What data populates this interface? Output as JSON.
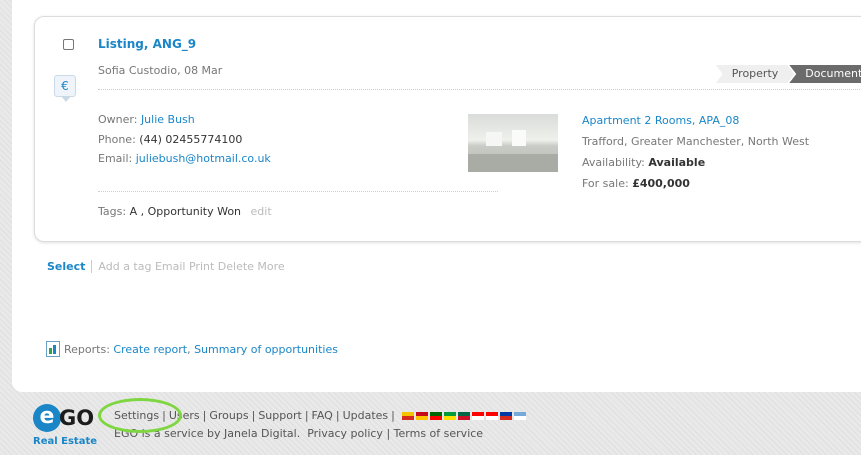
{
  "listing": {
    "title": "Listing, ANG_9",
    "subtitle": "Sofia Custodio, 08 Mar",
    "currency_icon": "€",
    "steps": [
      "Property",
      "Documents"
    ],
    "owner_label": "Owner:",
    "owner_name": "Julie Bush",
    "phone_label": "Phone:",
    "phone": "(44) 02455774100",
    "email_label": "Email:",
    "email": "juliebush@hotmail.co.uk",
    "property_title": "Apartment 2 Rooms, APA_08",
    "property_location": "Trafford, Greater Manchester, North West",
    "availability_label": "Availability:",
    "availability": "Available",
    "sale_label": "For sale:",
    "sale_price": "£400,000",
    "tags_label": "Tags:",
    "tags": "A , Opportunity Won",
    "edit_label": "edit"
  },
  "actions": {
    "select": "Select",
    "others": "Add a tag Email Print Delete More"
  },
  "reports": {
    "label": "Reports:",
    "create": "Create report",
    "comma": ",",
    "summary": "Summary of opportunities"
  },
  "footer": {
    "logo_e": "e",
    "logo_go": "GO",
    "logo_sub": "Real Estate",
    "nav": [
      "Settings",
      "Users",
      "Groups",
      "Support",
      "FAQ",
      "Updates"
    ],
    "separator": "|",
    "service_text": "EGO is a service by Janela Digital.",
    "privacy": "Privacy policy",
    "terms": "Terms of service",
    "flag_colors": [
      [
        "#f4c400",
        "#d52b1e"
      ],
      [
        "#c60b1e",
        "#ffc400"
      ],
      [
        "#006600",
        "#ff0000"
      ],
      [
        "#009c3b",
        "#ffdf00"
      ],
      [
        "#006847",
        "#ce1126"
      ],
      [
        "#ff0000",
        "#ffffff"
      ],
      [
        "#ff0000",
        "#ffffff"
      ],
      [
        "#0039a6",
        "#d52b1e"
      ],
      [
        "#75aadb",
        "#ffffff"
      ]
    ]
  }
}
